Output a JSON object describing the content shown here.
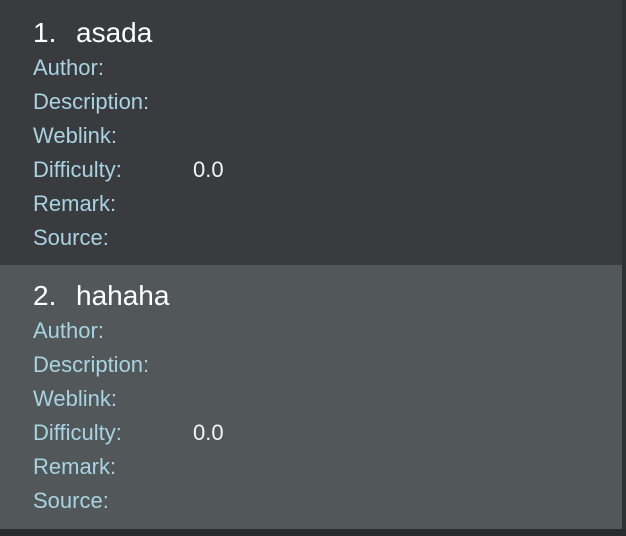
{
  "items": [
    {
      "index": "1.",
      "name": "asada",
      "fields": [
        {
          "label": "Author:",
          "value": ""
        },
        {
          "label": "Description:",
          "value": ""
        },
        {
          "label": "Weblink:",
          "value": ""
        },
        {
          "label": "Difficulty:",
          "value": "0.0"
        },
        {
          "label": "Remark:",
          "value": ""
        },
        {
          "label": "Source:",
          "value": ""
        }
      ]
    },
    {
      "index": "2.",
      "name": "hahaha",
      "fields": [
        {
          "label": "Author:",
          "value": ""
        },
        {
          "label": "Description:",
          "value": ""
        },
        {
          "label": "Weblink:",
          "value": ""
        },
        {
          "label": "Difficulty:",
          "value": "0.0"
        },
        {
          "label": "Remark:",
          "value": ""
        },
        {
          "label": "Source:",
          "value": ""
        }
      ]
    }
  ],
  "colors": {
    "card_dark": "#3a3b3e",
    "card_selected": "#525859",
    "label": "#a8d3e2",
    "text": "#ffffff"
  }
}
